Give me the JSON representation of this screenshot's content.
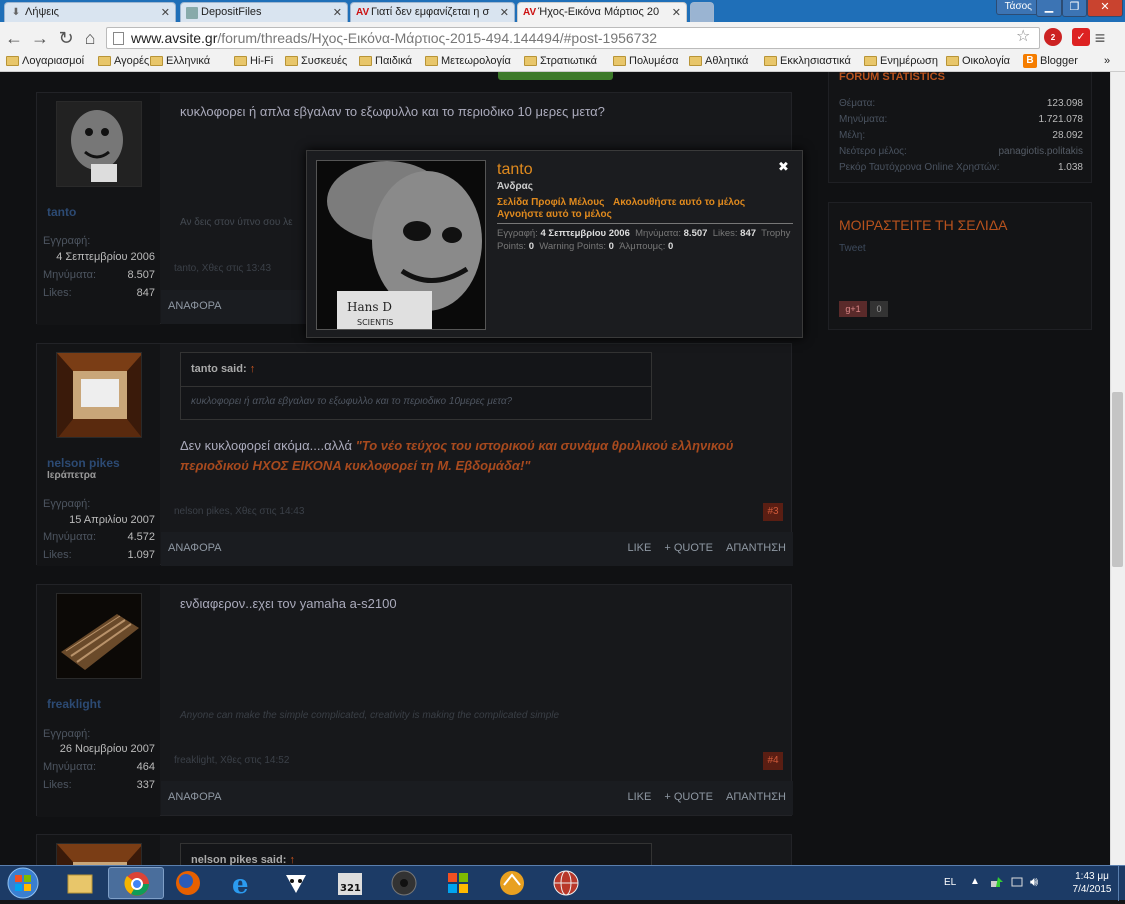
{
  "browser": {
    "tabs": [
      {
        "label": "Λήψεις",
        "icon": "download-icon"
      },
      {
        "label": "DepositFiles",
        "icon": "depositfiles-icon"
      },
      {
        "label": "Γιατί δεν εμφανίζεται η σ",
        "icon": "av-logo-icon"
      },
      {
        "label": "Ήχος-Εικόνα Μάρτιος 20",
        "icon": "av-logo-icon"
      }
    ],
    "user_button": "Τάσος",
    "url_host": "www.avsite.gr",
    "url_path": "/forum/threads/Ηχος-Εικόνα-Μάρτιος-2015-494.144494/#post-1956732",
    "extension_badge": "2",
    "bookmarks": [
      "Λογαριασμοί",
      "Αγορές",
      "Ελληνικά",
      "Hi-Fi",
      "Συσκευές",
      "Παιδικά",
      "Μετεωρολογία",
      "Στρατιωτικά",
      "Πολυμέσα",
      "Αθλητικά",
      "Εκκλησιαστικά",
      "Ενημέρωση",
      "Οικολογία",
      "Blogger"
    ],
    "more_bookmarks": "»"
  },
  "posts": [
    {
      "author": "tanto",
      "user_title": "",
      "join_label": "Εγγραφή:",
      "join_date": "4 Σεπτεμβρίου 2006",
      "messages_label": "Μηνύματα:",
      "messages": "8.507",
      "likes_label": "Likes:",
      "likes": "847",
      "content": "κυκλοφορει ή απλα εβγαλαν το εξωφυλλο και το περιοδικο 10 μερες μετα?",
      "signature": "Αν δεις στον ύπνο σου λε",
      "meta": "tanto, Χθες στις 13:43",
      "report": "ΑΝΑΦΟΡΑ"
    },
    {
      "author": "nelson pikes",
      "user_title": "Ιεράπετρα",
      "join_label": "Εγγραφή:",
      "join_date": "15 Απριλίου 2007",
      "messages_label": "Μηνύματα:",
      "messages": "4.572",
      "likes_label": "Likes:",
      "likes": "1.097",
      "quote_author": "tanto said:",
      "quote_text": "κυκλοφορει ή απλα εβγαλαν το εξωφυλλο και το περιοδικο 10μερες μετα?",
      "content_plain": "Δεν κυκλοφορεί ακόμα....αλλά",
      "content_highlight_1": "\"Το νέο τεύχος του ιστορικού και συνάμα θρυλικού ελληνικού",
      "content_highlight_2": "περιοδικού ΗΧΟΣ ΕΙΚΟΝΑ κυκλοφορεί τη Μ. Εβδομάδα!\"",
      "meta": "nelson pikes, Χθες στις 14:43",
      "post_number": "#3",
      "report": "ΑΝΑΦΟΡΑ",
      "like": "LIKE",
      "quote": "+ QUOTE",
      "reply": "ΑΠΑΝΤΗΣΗ"
    },
    {
      "author": "freaklight",
      "user_title": "",
      "join_label": "Εγγραφή:",
      "join_date": "26 Νοεμβρίου 2007",
      "messages_label": "Μηνύματα:",
      "messages": "464",
      "likes_label": "Likes:",
      "likes": "337",
      "content": "ενδιαφερον..εχει τον yamaha a-s2100",
      "signature": "Anyone can make the simple complicated, creativity is making the complicated simple",
      "meta": "freaklight, Χθες στις 14:52",
      "post_number": "#4",
      "report": "ΑΝΑΦΟΡΑ",
      "like": "LIKE",
      "quote": "+ QUOTE",
      "reply": "ΑΠΑΝΤΗΣΗ"
    },
    {
      "quote_author": "nelson pikes said:"
    }
  ],
  "sidebar": {
    "stats_title": "FORUM STATISTICS",
    "stats": [
      {
        "label": "Θέματα:",
        "value": "123.098"
      },
      {
        "label": "Μηνύματα:",
        "value": "1.721.078"
      },
      {
        "label": "Μέλη:",
        "value": "28.092"
      },
      {
        "label": "Νεότερο μέλος:",
        "value": "panagiotis.politakis"
      },
      {
        "label": "Ρεκόρ Ταυτόχρονα Online Χρηστών:",
        "value": "1.038"
      }
    ],
    "share_title": "ΜΟΙΡΑΣΤΕΙΤΕ ΤΗ ΣΕΛΙΔΑ",
    "tweet": "Tweet",
    "gplus": "g+1",
    "gplus_count": "0"
  },
  "popup": {
    "name": "tanto",
    "gender": "Άνδρας",
    "profile_link": "Σελίδα Προφίλ Μέλους",
    "follow_link": "Ακολουθήστε αυτό το μέλος",
    "ignore_link": "Αγνοήστε αυτό το μέλος",
    "join_label": "Εγγραφή:",
    "join_date": "4 Σεπτεμβρίου 2006",
    "messages_label": "Μηνύματα:",
    "messages": "8.507",
    "likes_label": "Likes:",
    "likes": "847",
    "trophy_label": "Trophy Points:",
    "trophy": "0",
    "warning_label": "Warning Points:",
    "warning": "0",
    "ampoules_label": "Άλμπουμς:",
    "ampoules": "0",
    "photo_caption": "Hans D SCIENTIST"
  },
  "taskbar": {
    "language": "EL",
    "time": "1:43 μμ",
    "date": "7/4/2015",
    "apps": [
      "explorer-icon",
      "chrome-icon",
      "firefox-icon",
      "ie-icon",
      "vlc-alien-icon",
      "media-player-classic-icon",
      "speaker-icon",
      "windows-flag-icon",
      "winamp-icon",
      "globe-icon"
    ]
  }
}
